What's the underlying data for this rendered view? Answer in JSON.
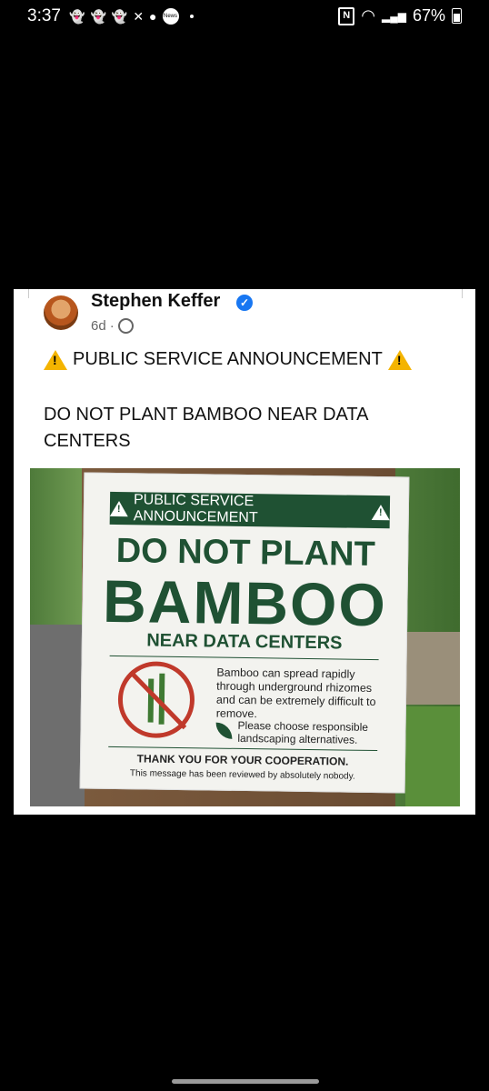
{
  "status_bar": {
    "time": "3:37",
    "notification_badge": "News",
    "battery": "67%"
  },
  "post": {
    "author": "Stephen Keffer",
    "verified_mark": "✓",
    "age": "6d",
    "age_separator": "·",
    "headline": "PUBLIC SERVICE ANNOUNCEMENT",
    "text": "DO NOT PLANT BAMBOO NEAR DATA CENTERS"
  },
  "sign": {
    "psa": "PUBLIC SERVICE ANNOUNCEMENT",
    "line1": "DO NOT PLANT",
    "line2": "BAMBOO",
    "line3": "NEAR DATA CENTERS",
    "description": "Bamboo can spread rapidly through underground rhizomes and can be extremely difficult to remove.",
    "alternatives": "Please choose responsible landscaping alternatives.",
    "thanks": "THANK YOU FOR YOUR COOPERATION.",
    "reviewed": "This message has been reviewed by absolutely nobody."
  },
  "colors": {
    "verified": "#1877f2",
    "warning": "#f4b400",
    "sign_green": "#1f5133",
    "prohibition_red": "#c0392b"
  }
}
